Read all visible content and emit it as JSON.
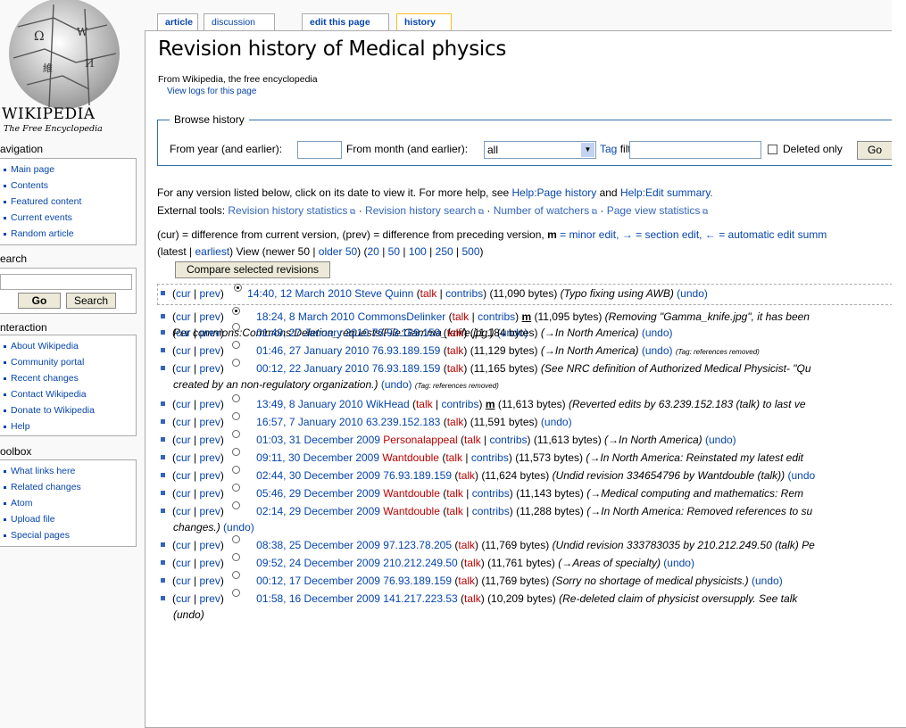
{
  "sidebar": {
    "logo_title": "WIKIPEDIA",
    "logo_subtitle": "The Free Encyclopedia",
    "navigation_heading": "avigation",
    "navigation": [
      "Main page",
      "Contents",
      "Featured content",
      "Current events",
      "Random article"
    ],
    "search_heading": "earch",
    "go_label": "Go",
    "search_label": "Search",
    "interaction_heading": "nteraction",
    "interaction": [
      "About Wikipedia",
      "Community portal",
      "Recent changes",
      "Contact Wikipedia",
      "Donate to Wikipedia",
      "Help"
    ],
    "toolbox_heading": "oolbox",
    "toolbox": [
      "What links here",
      "Related changes",
      "Atom",
      "Upload file",
      "Special pages"
    ]
  },
  "tabs": [
    "article",
    "discussion",
    "edit this page",
    "history"
  ],
  "page": {
    "title": "Revision history of Medical physics",
    "from": "From Wikipedia, the free encyclopedia",
    "view_logs": "View logs for this page"
  },
  "browse": {
    "legend": "Browse history",
    "year_label": "From year (and earlier):",
    "year_value": "",
    "month_label": "From month (and earlier):",
    "month_value": "all",
    "tag_label": "Tag",
    "filter_label": "filter:",
    "tag_value": "",
    "deleted_label": "Deleted only",
    "go_label": "Go"
  },
  "help": {
    "line1_pre": "For any version listed below, click on its date to view it. For more help, see",
    "help_page": "Help:Page history",
    "and": "and",
    "help_edit": "Help:Edit summary.",
    "tools_label": "External tools:",
    "tools": [
      "Revision history statistics",
      "Revision history search",
      "Number of watchers",
      "Page view statistics"
    ]
  },
  "legend_line": {
    "a": "(cur) = difference from current version, (prev) = difference from preceding version,",
    "m": "m",
    "b": "= minor edit, → = section edit, ← = automatic edit summ"
  },
  "paging": {
    "a": "(latest |",
    "earliest": "earliest",
    "b": ") View (newer 50 |",
    "older": "older 50",
    "c": ") (",
    "n20": "20",
    "n50": "50",
    "n100": "100",
    "n250": "250",
    "n500": "500",
    "d": ")"
  },
  "compare_label": "Compare selected revisions",
  "revisions": [
    {
      "cur": "cur",
      "prev": "prev",
      "date": "14:40, 12 March 2010",
      "user": "Steve Quinn",
      "talk": "talk",
      "contribs": "contribs",
      "minor": "",
      "bytes": "(11,090 bytes)",
      "summary": "(Typo fixing using AWB)",
      "undo": "(undo)",
      "tag": ""
    },
    {
      "cur": "cur",
      "prev": "prev",
      "date": "18:24, 8 March 2010",
      "user": "CommonsDelinker",
      "talk": "talk",
      "contribs": "contribs",
      "minor": "m",
      "bytes": "(11,095 bytes)",
      "summary": "(Removing \"Gamma_knife.jpg\", it has been",
      "cont": "Per commons:Commons:Deletion_requests/File:Gamma_knife.jpg.)",
      "undo": "(undo)",
      "tag": ""
    },
    {
      "cur": "cur",
      "prev": "prev",
      "date": "01:49, 27 January 2010",
      "user": "76.93.189.159",
      "talk": "talk",
      "contribs": "",
      "minor": "",
      "bytes": "(11,184 bytes)",
      "summary": "(→In North America)",
      "undo": "(undo)",
      "tag": ""
    },
    {
      "cur": "cur",
      "prev": "prev",
      "date": "01:46, 27 January 2010",
      "user": "76.93.189.159",
      "talk": "talk",
      "contribs": "",
      "minor": "",
      "bytes": "(11,129 bytes)",
      "summary": "(→In North America)",
      "undo": "(undo)",
      "tag": "(Tag: references removed)"
    },
    {
      "cur": "cur",
      "prev": "prev",
      "date": "00:12, 22 January 2010",
      "user": "76.93.189.159",
      "talk": "talk",
      "contribs": "",
      "minor": "",
      "bytes": "(11,165 bytes)",
      "summary": "(See NRC definition of Authorized Medical Physicist- \"Qu",
      "cont": "created by an non-regulatory organization.)",
      "undo": "(undo)",
      "tag": "(Tag: references removed)"
    },
    {
      "cur": "cur",
      "prev": "prev",
      "date": "13:49, 8 January 2010",
      "user": "WikHead",
      "talk": "talk",
      "contribs": "contribs",
      "minor": "m",
      "bytes": "(11,613 bytes)",
      "summary": "(Reverted edits by 63.239.152.183 (talk) to last ve",
      "undo": "",
      "tag": ""
    },
    {
      "cur": "cur",
      "prev": "prev",
      "date": "16:57, 7 January 2010",
      "user": "63.239.152.183",
      "talk": "talk",
      "contribs": "",
      "minor": "",
      "bytes": "(11,591 bytes)",
      "summary": "",
      "undo": "(undo)",
      "tag": ""
    },
    {
      "cur": "cur",
      "prev": "prev",
      "date": "01:03, 31 December 2009",
      "user": "Personalappeal",
      "talk": "talk",
      "contribs": "contribs",
      "minor": "",
      "bytes": "(11,613 bytes)",
      "summary": "(→In North America)",
      "undo": "(undo)",
      "tag": ""
    },
    {
      "cur": "cur",
      "prev": "prev",
      "date": "09:11, 30 December 2009",
      "user": "Wantdouble",
      "talk": "talk",
      "contribs": "contribs",
      "minor": "",
      "bytes": "(11,573 bytes)",
      "summary": "(→In North America: Reinstated my latest edit",
      "undo": "",
      "tag": ""
    },
    {
      "cur": "cur",
      "prev": "prev",
      "date": "02:44, 30 December 2009",
      "user": "76.93.189.159",
      "talk": "talk",
      "contribs": "",
      "minor": "",
      "bytes": "(11,624 bytes)",
      "summary": "(Undid revision 334654796 by Wantdouble (talk))",
      "undo": "(undo",
      "tag": ""
    },
    {
      "cur": "cur",
      "prev": "prev",
      "date": "05:46, 29 December 2009",
      "user": "Wantdouble",
      "talk": "talk",
      "contribs": "contribs",
      "minor": "",
      "bytes": "(11,143 bytes)",
      "summary": "(→Medical computing and mathematics: Rem",
      "undo": "",
      "tag": ""
    },
    {
      "cur": "cur",
      "prev": "prev",
      "date": "02:14, 29 December 2009",
      "user": "Wantdouble",
      "talk": "talk",
      "contribs": "contribs",
      "minor": "",
      "bytes": "(11,288 bytes)",
      "summary": "(→In North America: Removed references to su",
      "cont": "changes.)",
      "undo": "(undo)",
      "tag": ""
    },
    {
      "cur": "cur",
      "prev": "prev",
      "date": "08:38, 25 December 2009",
      "user": "97.123.78.205",
      "talk": "talk",
      "contribs": "",
      "minor": "",
      "bytes": "(11,769 bytes)",
      "summary": "(Undid revision 333783035 by 210.212.249.50 (talk) Pe",
      "undo": "",
      "tag": ""
    },
    {
      "cur": "cur",
      "prev": "prev",
      "date": "09:52, 24 December 2009",
      "user": "210.212.249.50",
      "talk": "talk",
      "contribs": "",
      "minor": "",
      "bytes": "(11,761 bytes)",
      "summary": "(→Areas of specialty)",
      "undo": "(undo)",
      "tag": ""
    },
    {
      "cur": "cur",
      "prev": "prev",
      "date": "00:12, 17 December 2009",
      "user": "76.93.189.159",
      "talk": "talk",
      "contribs": "",
      "minor": "",
      "bytes": "(11,769 bytes)",
      "summary": "(Sorry no shortage of medical physicists.)",
      "undo": "(undo)",
      "tag": ""
    },
    {
      "cur": "cur",
      "prev": "prev",
      "date": "01:58, 16 December 2009",
      "user": "141.217.223.53",
      "talk": "talk",
      "contribs": "",
      "minor": "",
      "bytes": "(10,209 bytes)",
      "summary": "(Re-deleted claim of physicist oversupply. See talk",
      "cont": "(undo)",
      "undo": "",
      "tag": ""
    }
  ]
}
